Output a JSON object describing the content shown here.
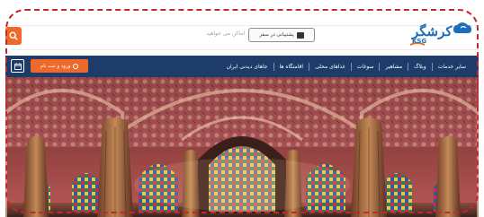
{
  "header": {
    "search": {
      "placeholder": "اماکن می خواهید"
    },
    "support_label": "پشتیبانی در سفر",
    "logo": {
      "text": "کرشگر",
      "subtext": "KSG"
    }
  },
  "nav": {
    "items": [
      "جاهای دیدنی ایران",
      "اقامتگاه ها",
      "غذاهای محلی",
      "سوغات",
      "مشاهیر",
      "وبلاگ",
      "سایر خدمات"
    ],
    "login_label": "ورود و ثبت نام"
  },
  "colors": {
    "navbar": "#1d3c69",
    "accent": "#ef6a2a",
    "frame": "#c2272d",
    "logo": "#1b6fb8"
  },
  "icons": [
    "search-icon",
    "support-icon",
    "user-icon",
    "calendar-icon"
  ]
}
